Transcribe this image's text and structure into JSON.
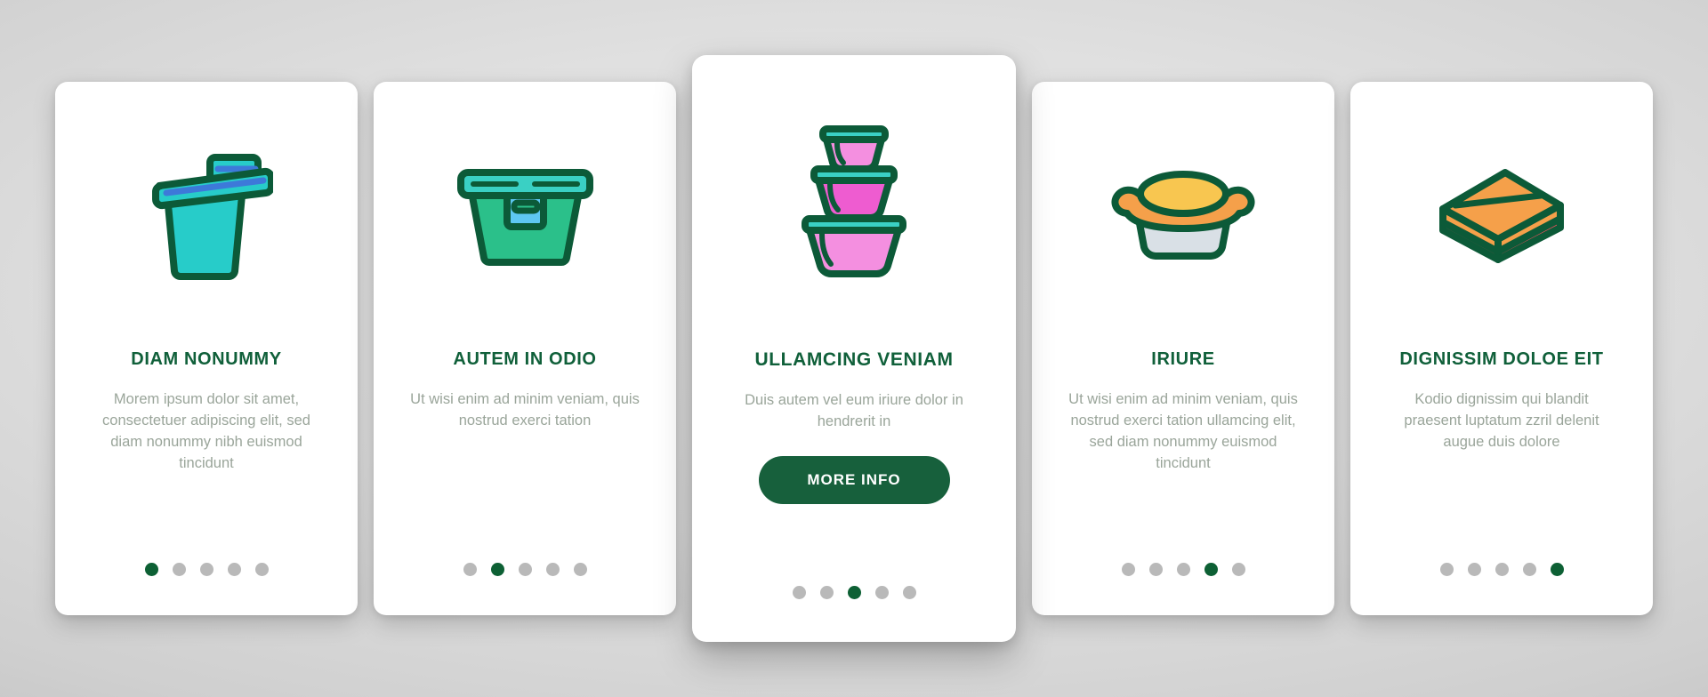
{
  "theme": {
    "accent_green": "#0d6034",
    "title_green": "#10603a",
    "body_gray": "#9aa59a",
    "dot_inactive": "#b9b9b9",
    "card_bg": "#ffffff",
    "page_bg": "#d0d0d0"
  },
  "cards": [
    {
      "icon": "food-container-bucket-icon",
      "title": "DIAM NONUMMY",
      "body": "Morem ipsum dolor sit amet, consectetuer adipiscing elit, sed diam nonummy nibh euismod tincidunt",
      "dots": 5,
      "active_dot": 1,
      "featured": false,
      "button_label": null
    },
    {
      "icon": "lunch-box-container-icon",
      "title": "AUTEM IN ODIO",
      "body": "Ut wisi enim ad minim veniam, quis nostrud exerci tation",
      "dots": 5,
      "active_dot": 2,
      "featured": false,
      "button_label": null
    },
    {
      "icon": "stacked-bowls-icon",
      "title": "ULLAMCING VENIAM",
      "body": "Duis autem vel eum iriure dolor in hendrerit in",
      "dots": 5,
      "active_dot": 3,
      "featured": true,
      "button_label": "MORE INFO"
    },
    {
      "icon": "covered-bowl-icon",
      "title": "IRIURE",
      "body": "Ut wisi enim ad minim veniam, quis nostrud exerci tation ullamcing elit, sed diam nonummy euismod tincidunt",
      "dots": 5,
      "active_dot": 4,
      "featured": false,
      "button_label": null
    },
    {
      "icon": "lidded-storage-box-icon",
      "title": "DIGNISSIM DOLOE EIT",
      "body": "Kodio dignissim qui blandit praesent luptatum zzril delenit augue duis dolore",
      "dots": 5,
      "active_dot": 5,
      "featured": false,
      "button_label": null
    }
  ]
}
